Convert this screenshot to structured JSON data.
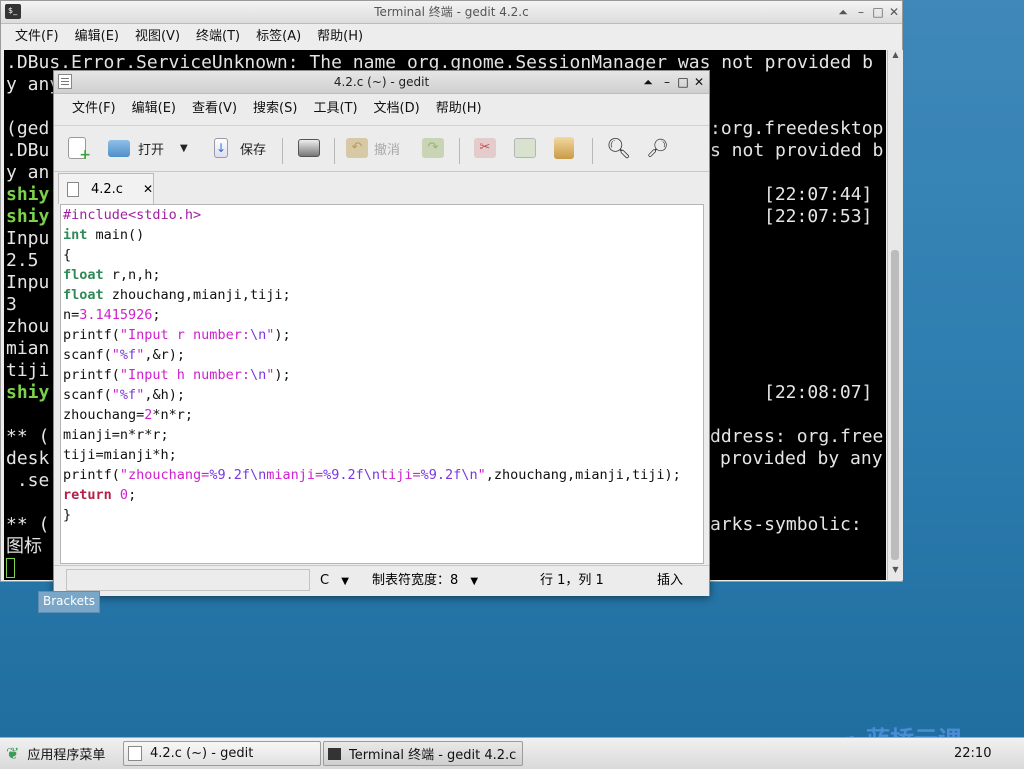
{
  "terminal": {
    "title": "Terminal 终端 - gedit 4.2.c",
    "menu": [
      "文件(F)",
      "编辑(E)",
      "视图(V)",
      "终端(T)",
      "标签(A)",
      "帮助(H)"
    ],
    "lines_left": [
      ".DBus.Error.ServiceUnknown: The name org.gnome.SessionManager was not provided b",
      "y any",
      "",
      "(ged",
      ".DBu",
      "y an",
      "shiy",
      "shiy",
      "Inpu",
      "2.5",
      "Inpu",
      "3",
      "zhou",
      "mian",
      "tiji",
      "shiy",
      "",
      "** (",
      "desk",
      " .se",
      "",
      "** (",
      "图标"
    ],
    "lines_right": {
      "r3": ":org.freedesktop",
      "r4": "s not provided b",
      "r6": "[22:07:44]",
      "r7": "[22:07:53]",
      "r15": "[22:08:07]",
      "r17": "ddress: org.free",
      "r18": "provided by any",
      "r21": "arks-symbolic:"
    }
  },
  "gedit": {
    "title": "4.2.c (~) - gedit",
    "menu": [
      "文件(F)",
      "编辑(E)",
      "查看(V)",
      "搜索(S)",
      "工具(T)",
      "文档(D)",
      "帮助(H)"
    ],
    "toolbar": {
      "open": "打开",
      "save": "保存",
      "undo": "撤消"
    },
    "tab_label": "4.2.c",
    "code": [
      "#include<stdio.h>",
      "int main()",
      "{",
      "float r,n,h;",
      "float zhouchang,mianji,tiji;",
      "n=3.1415926;",
      "printf(\"Input r number:\\n\");",
      "scanf(\"%f\",&r);",
      "printf(\"Input h number:\\n\");",
      "scanf(\"%f\",&h);",
      "zhouchang=2*n*r;",
      "mianji=n*r*r;",
      "tiji=mianji*h;",
      "printf(\"zhouchang=%9.2f\\nmianji=%9.2f\\ntiji=%9.2f\\n\",zhouchang,mianji,tiji);",
      "return 0;",
      "}"
    ],
    "status": {
      "language": "C",
      "tab_width": "制表符宽度：8",
      "position": "行 1，列 1",
      "mode": "插入"
    }
  },
  "tooltip": "Brackets",
  "taskbar": {
    "app_menu": "应用程序菜单",
    "items": [
      "4.2.c (~) - gedit",
      "Terminal 终端 - gedit 4.2.c"
    ],
    "clock": "22:10"
  },
  "watermark": "蓝桥云课",
  "colors": {
    "keyword": "#2e8b57",
    "string": "#d020d0",
    "prompt": "#7cd24a",
    "desktop": "#2f7fb2"
  }
}
